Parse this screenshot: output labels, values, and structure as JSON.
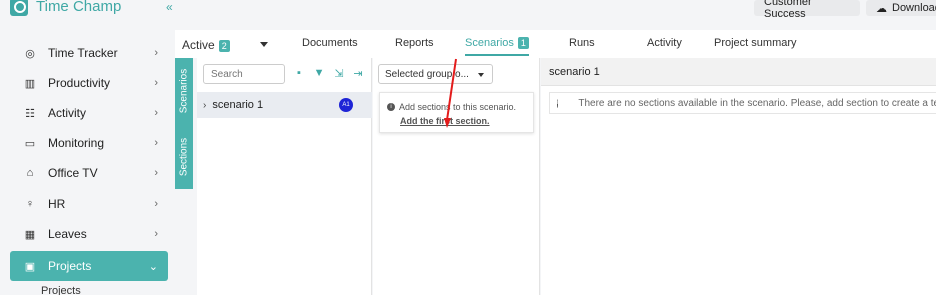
{
  "app": {
    "name": "Time Champ",
    "collapse_icon": "double-chevron-left-icon"
  },
  "header": {
    "buttons": [
      {
        "label": "Customer Success"
      },
      {
        "label": "Download",
        "icon": "cloud-download-icon"
      }
    ]
  },
  "sidebar": {
    "items": [
      {
        "label": "Time Tracker",
        "icon": "target-icon"
      },
      {
        "label": "Productivity",
        "icon": "chart-icon"
      },
      {
        "label": "Activity",
        "icon": "activity-icon"
      },
      {
        "label": "Monitoring",
        "icon": "monitor-icon"
      },
      {
        "label": "Office TV",
        "icon": "tv-icon"
      },
      {
        "label": "HR",
        "icon": "user-icon"
      },
      {
        "label": "Leaves",
        "icon": "calendar-icon"
      },
      {
        "label": "Projects",
        "icon": "briefcase-icon",
        "active": true
      }
    ],
    "sub_items": [
      "Projects"
    ]
  },
  "tabs": {
    "status": {
      "label": "Active",
      "count": "2"
    },
    "items": [
      {
        "label": "Documents"
      },
      {
        "label": "Reports"
      },
      {
        "label": "Scenarios",
        "count": "1",
        "active": true
      },
      {
        "label": "Runs"
      },
      {
        "label": "Activity"
      },
      {
        "label": "Project summary"
      }
    ]
  },
  "side_tabs": {
    "scenarios": "Scenarios",
    "sections": "Sections"
  },
  "tree": {
    "search_placeholder": "Search",
    "rows": [
      {
        "label": "scenario 1",
        "avatar": "A1"
      }
    ]
  },
  "groups": {
    "select_label": "Selected group o...",
    "info_text": "Add sections to this scenario.",
    "link_text": "Add the first section."
  },
  "detail": {
    "title": "scenario 1",
    "message": "There are no sections available in the scenario. Please, add section to create a test case."
  },
  "colors": {
    "accent": "#3fa8a5",
    "accent_fill": "#4bb3ae",
    "annotation_arrow": "#e31b1b",
    "avatar": "#1e24d6"
  }
}
